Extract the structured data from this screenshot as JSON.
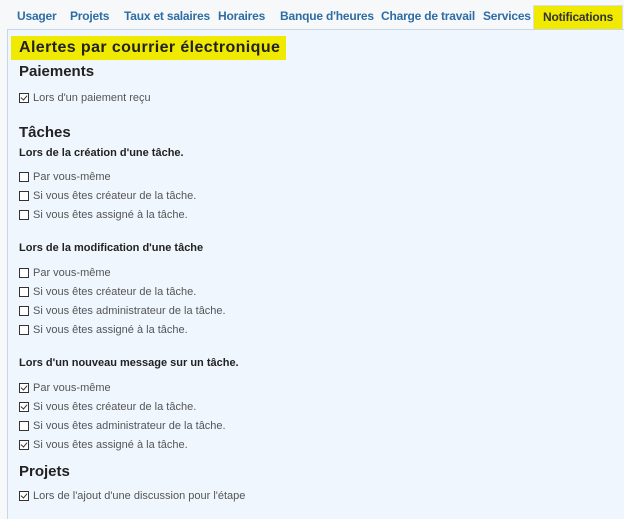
{
  "tabs": [
    {
      "label": "Usager",
      "active": false
    },
    {
      "label": "Projets",
      "active": false
    },
    {
      "label": "Taux et salaires",
      "active": false
    },
    {
      "label": "Horaires",
      "active": false
    },
    {
      "label": "Banque d'heures",
      "active": false
    },
    {
      "label": "Charge de travail",
      "active": false
    },
    {
      "label": "Services",
      "active": false
    },
    {
      "label": "Notifications",
      "active": true
    }
  ],
  "page_title": "Alertes par courrier électronique",
  "sections": {
    "paiements": {
      "title": "Paiements",
      "options": [
        {
          "label": "Lors d'un paiement reçu",
          "checked": true
        }
      ]
    },
    "taches": {
      "title": "Tâches",
      "groups": [
        {
          "title": "Lors de la création d'une tâche.",
          "options": [
            {
              "label": "Par vous-même",
              "checked": false
            },
            {
              "label": "Si vous êtes créateur de la tâche.",
              "checked": false
            },
            {
              "label": "Si vous êtes assigné à la tâche.",
              "checked": false
            }
          ]
        },
        {
          "title": "Lors de la modification d'une tâche",
          "options": [
            {
              "label": "Par vous-même",
              "checked": false
            },
            {
              "label": "Si vous êtes créateur de la tâche.",
              "checked": false
            },
            {
              "label": "Si vous êtes administrateur de la tâche.",
              "checked": false
            },
            {
              "label": "Si vous êtes assigné à la tâche.",
              "checked": false
            }
          ]
        },
        {
          "title": "Lors d'un nouveau message sur un tâche.",
          "options": [
            {
              "label": "Par vous-même",
              "checked": true
            },
            {
              "label": "Si vous êtes créateur de la tâche.",
              "checked": true
            },
            {
              "label": "Si vous êtes administrateur de la tâche.",
              "checked": false
            },
            {
              "label": "Si vous êtes assigné à la tâche.",
              "checked": true
            }
          ]
        }
      ]
    },
    "projets": {
      "title": "Projets",
      "options": [
        {
          "label": "Lors de l'ajout d'une discussion pour l'étape",
          "checked": true
        }
      ]
    }
  }
}
